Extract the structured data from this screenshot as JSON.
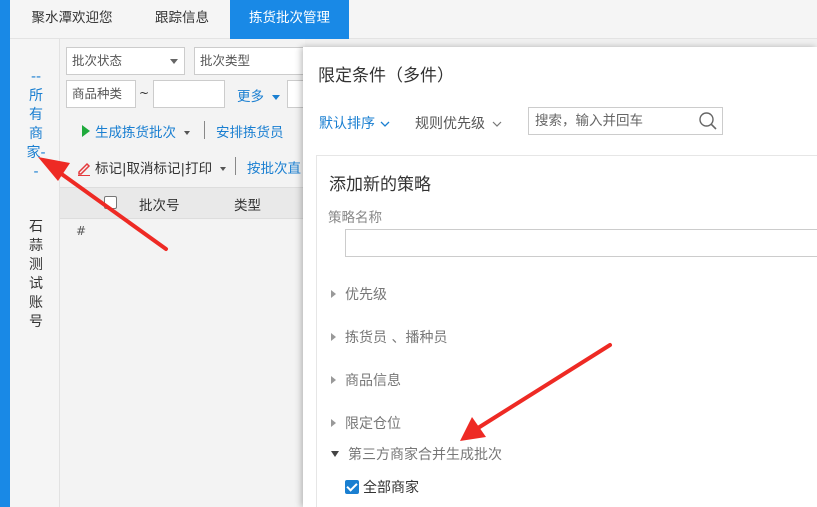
{
  "tabs": [
    "聚水潭欢迎您",
    "跟踪信息",
    "拣货批次管理"
  ],
  "merchant_column": {
    "all_merchants": "--所有商家--",
    "account": "石蒜测试账号"
  },
  "filters": {
    "batch_status": "批次状态",
    "batch_type": "批次类型",
    "product_kind": "商品种类",
    "range_sep": "~",
    "more": "更多"
  },
  "toolbar": {
    "generate_batch": "生成拣货批次",
    "assign_picker": "安排拣货员",
    "mark_unmark_print": "标记|取消标记|打印",
    "by_batch": "按批次直"
  },
  "grid": {
    "columns": [
      "批次号",
      "类型"
    ],
    "row_marker": "#"
  },
  "dialog": {
    "title": "限定条件（多件）",
    "sort_default": "默认排序",
    "rule_priority": "规则优先级",
    "search_placeholder": "搜索，输入并回车",
    "section_title": "添加新的策略",
    "name_label": "策略名称",
    "collapsibles": [
      "优先级",
      "拣货员 、播种员",
      "商品信息",
      "限定仓位"
    ],
    "expanded_section": "第三方商家合并生成批次",
    "all_merchants_checkbox": "全部商家"
  },
  "colors": {
    "accent": "#1989e6",
    "link": "#1a7fd1",
    "arrow": "#ee2a24"
  }
}
